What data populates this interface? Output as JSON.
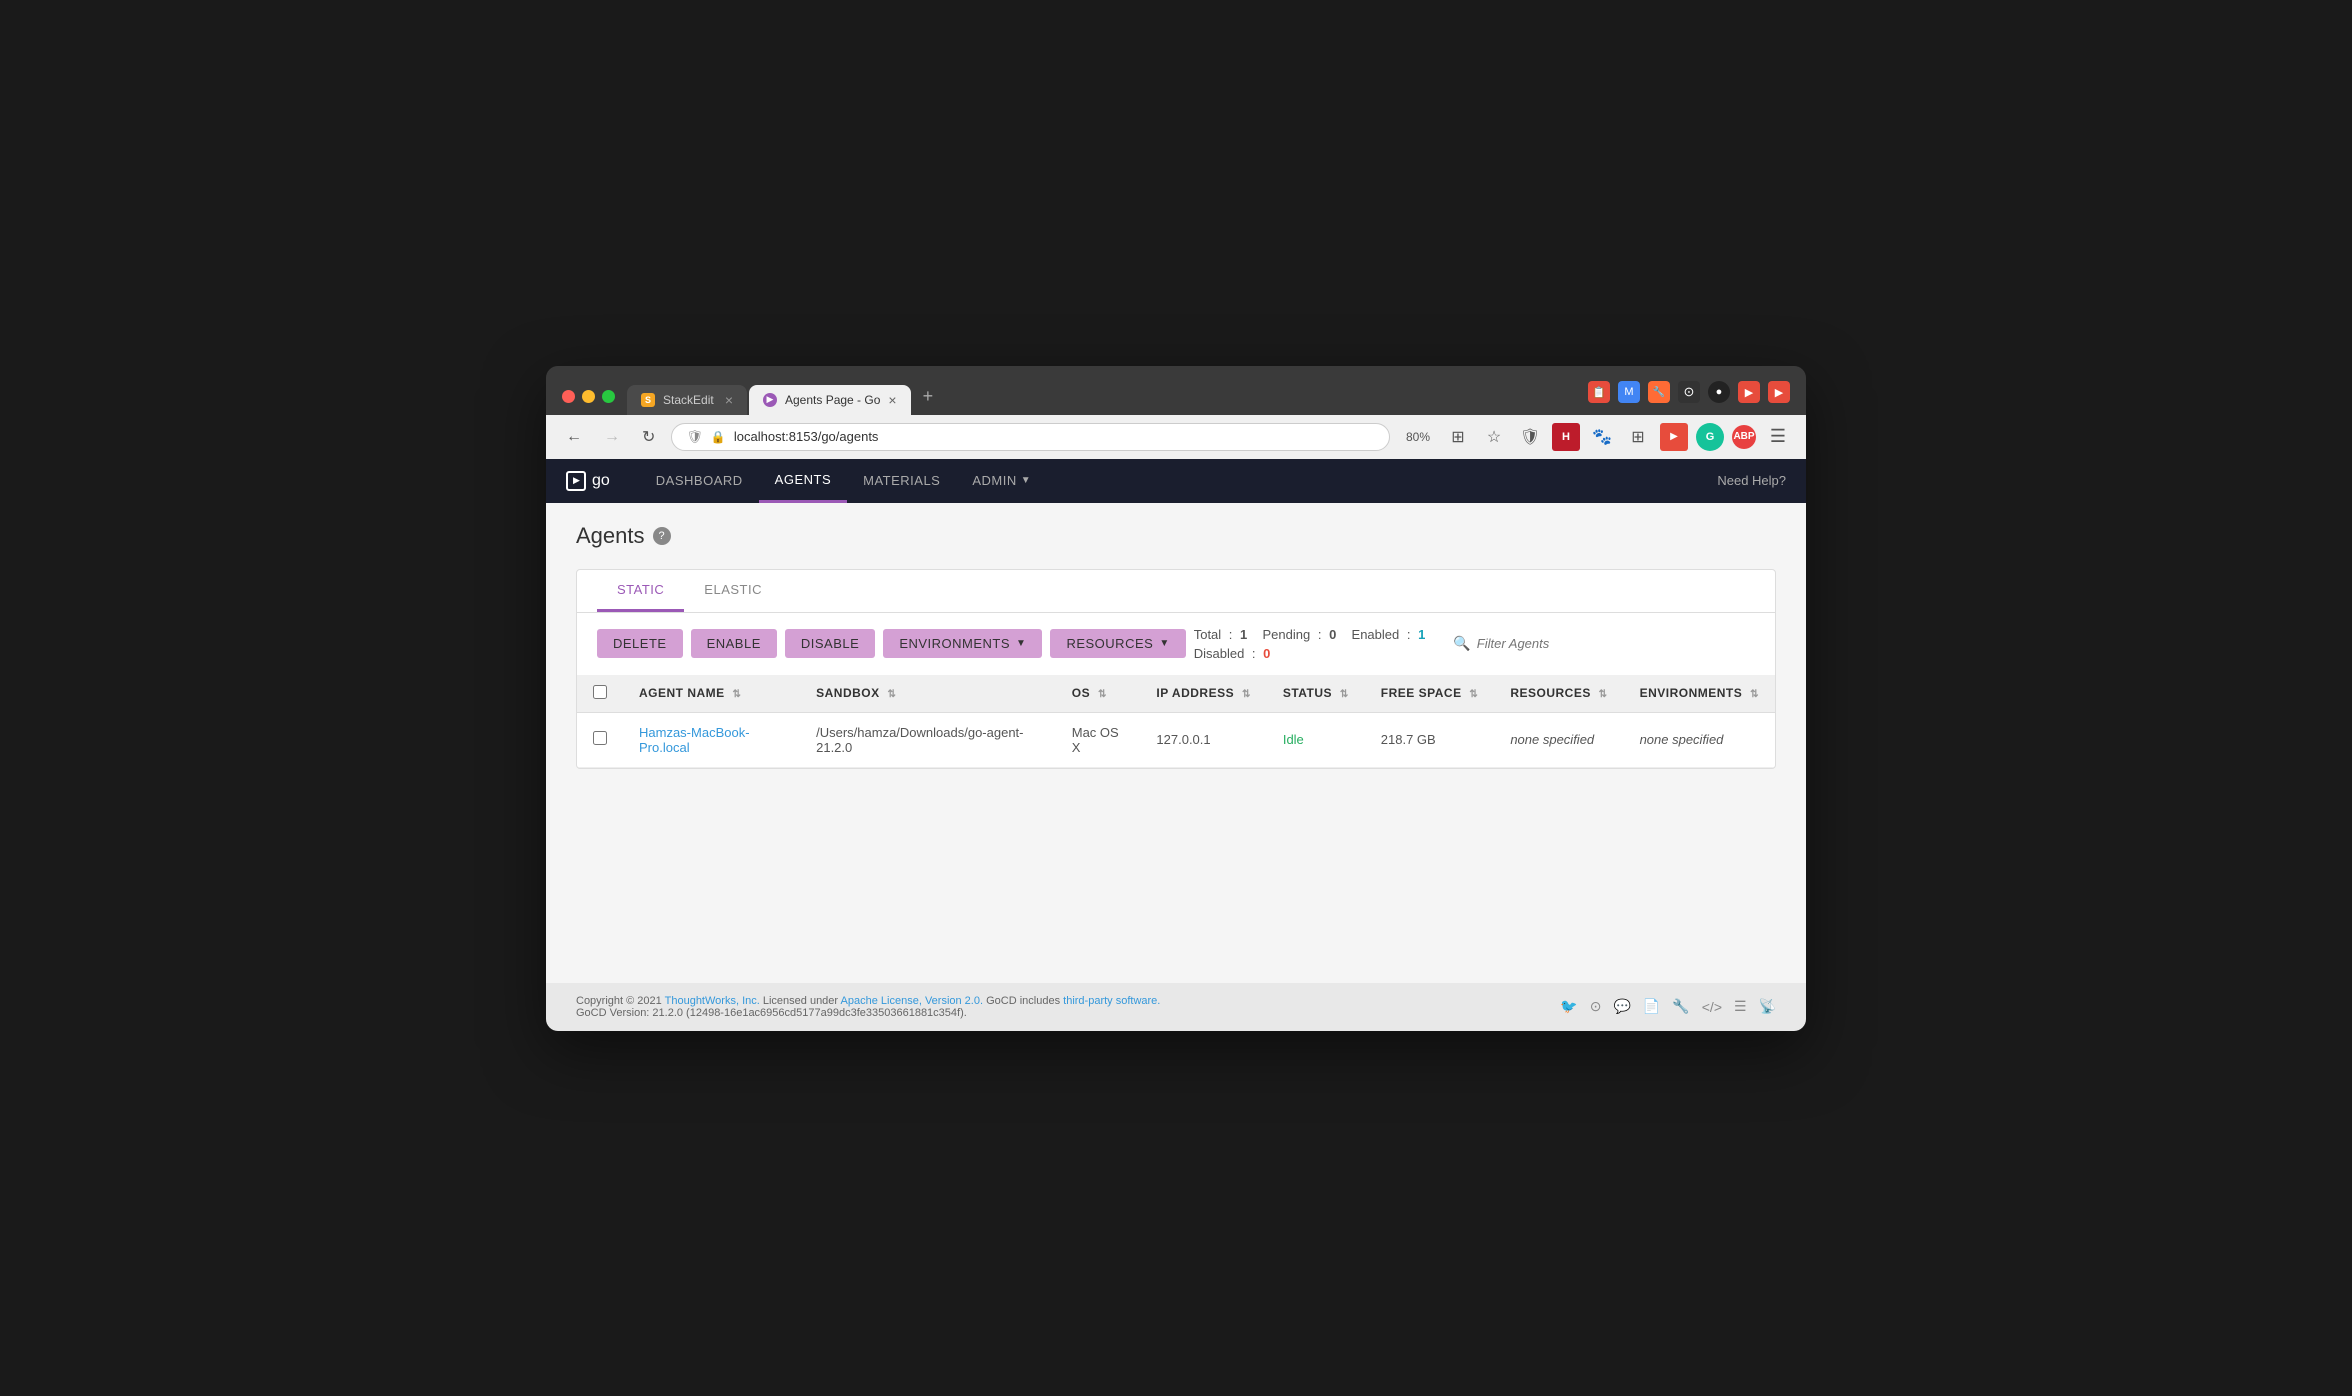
{
  "browser": {
    "tabs": [
      {
        "id": "stackedit",
        "label": "StackEdit",
        "icon": "S",
        "active": false
      },
      {
        "id": "agents",
        "label": "Agents Page - Go",
        "icon": "▶",
        "active": true
      }
    ],
    "add_tab_label": "+",
    "address": "localhost:8153/go/agents",
    "zoom": "80%",
    "back_disabled": false,
    "forward_disabled": true
  },
  "app": {
    "logo_text": "go",
    "nav": {
      "dashboard": "DASHBOARD",
      "agents": "AGENTS",
      "materials": "MATERIALS",
      "admin": "ADMIN",
      "help": "Need Help?"
    }
  },
  "page": {
    "title": "Agents",
    "help_icon": "?"
  },
  "tabs": {
    "static": "STATIC",
    "elastic": "ELASTIC",
    "active": "STATIC"
  },
  "toolbar": {
    "delete": "DELETE",
    "enable": "ENABLE",
    "disable": "DISABLE",
    "environments": "ENVIRONMENTS",
    "resources": "RESOURCES",
    "filter_placeholder": "Filter Agents",
    "stats": {
      "total_label": "Total",
      "total_value": "1",
      "pending_label": "Pending",
      "pending_value": "0",
      "enabled_label": "Enabled",
      "enabled_value": "1",
      "disabled_label": "Disabled",
      "disabled_value": "0"
    }
  },
  "table": {
    "columns": [
      {
        "id": "name",
        "label": "AGENT NAME"
      },
      {
        "id": "sandbox",
        "label": "SANDBOX"
      },
      {
        "id": "os",
        "label": "OS"
      },
      {
        "id": "ip",
        "label": "IP ADDRESS"
      },
      {
        "id": "status",
        "label": "STATUS"
      },
      {
        "id": "free_space",
        "label": "FREE SPACE"
      },
      {
        "id": "resources",
        "label": "RESOURCES"
      },
      {
        "id": "environments",
        "label": "ENVIRONMENTS"
      }
    ],
    "rows": [
      {
        "name": "Hamzas-MacBook-Pro.local",
        "sandbox": "/Users/hamza/Downloads/go-agent-21.2.0",
        "os": "Mac OS X",
        "ip": "127.0.0.1",
        "status": "Idle",
        "free_space": "218.7 GB",
        "resources": "none specified",
        "environments": "none specified"
      }
    ]
  },
  "footer": {
    "copyright": "Copyright © 2021",
    "thoughtworks": "ThoughtWorks, Inc.",
    "license_text": "Licensed under",
    "apache_license": "Apache License, Version 2.0.",
    "gocd_text": "GoCD includes",
    "third_party": "third-party software.",
    "version": "GoCD Version: 21.2.0 (12498-16e1ac6956cd5177a99dc3fe33503661881c354f)."
  }
}
